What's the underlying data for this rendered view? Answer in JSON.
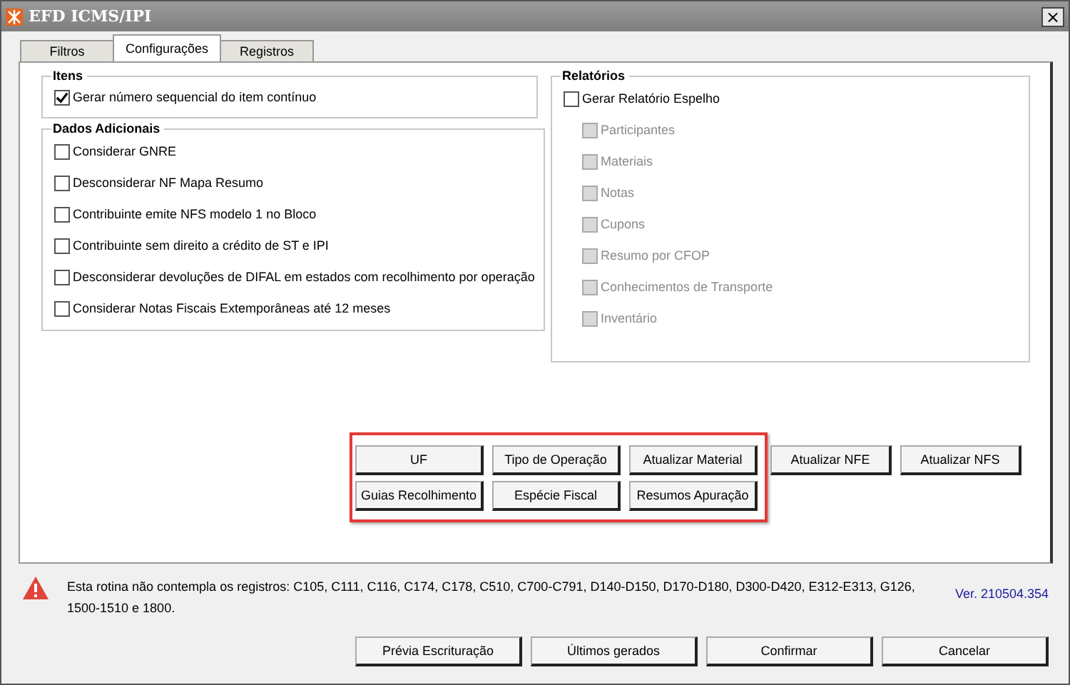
{
  "window": {
    "title": "EFD ICMS/IPI",
    "close_label": "×"
  },
  "tabs": [
    {
      "label": "Filtros",
      "selected": false
    },
    {
      "label": "Configurações",
      "selected": true
    },
    {
      "label": "Registros",
      "selected": false
    }
  ],
  "itens": {
    "title": "Itens",
    "options": [
      {
        "label": "Gerar número sequencial do item contínuo",
        "checked": true,
        "disabled": false
      }
    ]
  },
  "dados_adicionais": {
    "title": "Dados Adicionais",
    "options": [
      {
        "label": "Considerar GNRE",
        "checked": false,
        "disabled": false
      },
      {
        "label": "Desconsiderar NF Mapa Resumo",
        "checked": false,
        "disabled": false
      },
      {
        "label": "Contribuinte emite NFS modelo 1 no Bloco",
        "checked": false,
        "disabled": false
      },
      {
        "label": "Contribuinte sem direito a crédito de ST e IPI",
        "checked": false,
        "disabled": false
      },
      {
        "label": "Desconsiderar devoluções de DIFAL em estados com recolhimento por operação",
        "checked": false,
        "disabled": false
      },
      {
        "label": "Considerar Notas Fiscais Extemporâneas até 12 meses",
        "checked": false,
        "disabled": false
      }
    ]
  },
  "relatorios": {
    "title": "Relatórios",
    "main": {
      "label": "Gerar Relatório Espelho",
      "checked": false,
      "disabled": false
    },
    "options": [
      {
        "label": "Participantes",
        "checked": false,
        "disabled": true
      },
      {
        "label": "Materiais",
        "checked": false,
        "disabled": true
      },
      {
        "label": "Notas",
        "checked": false,
        "disabled": true
      },
      {
        "label": "Cupons",
        "checked": false,
        "disabled": true
      },
      {
        "label": "Resumo por CFOP",
        "checked": false,
        "disabled": true
      },
      {
        "label": "Conhecimentos de Transporte",
        "checked": false,
        "disabled": true
      },
      {
        "label": "Inventário",
        "checked": false,
        "disabled": true
      }
    ]
  },
  "highlighted_buttons": [
    [
      "UF",
      "Tipo de Operação",
      "Atualizar Material"
    ],
    [
      "Guias Recolhimento",
      "Espécie Fiscal",
      "Resumos Apuração"
    ]
  ],
  "other_buttons": [
    "Atualizar NFE",
    "Atualizar NFS"
  ],
  "warning": {
    "message": "Esta rotina não contempla os registros: C105, C111, C116, C174, C178, C510, C700-C791, D140-D150, D170-D180, D300-D420, E312-E313, G126, 1500-1510 e 1800.",
    "version": "Ver. 210504.354"
  },
  "footer_buttons": [
    "Prévia Escrituração",
    "Últimos gerados",
    "Confirmar",
    "Cancelar"
  ]
}
